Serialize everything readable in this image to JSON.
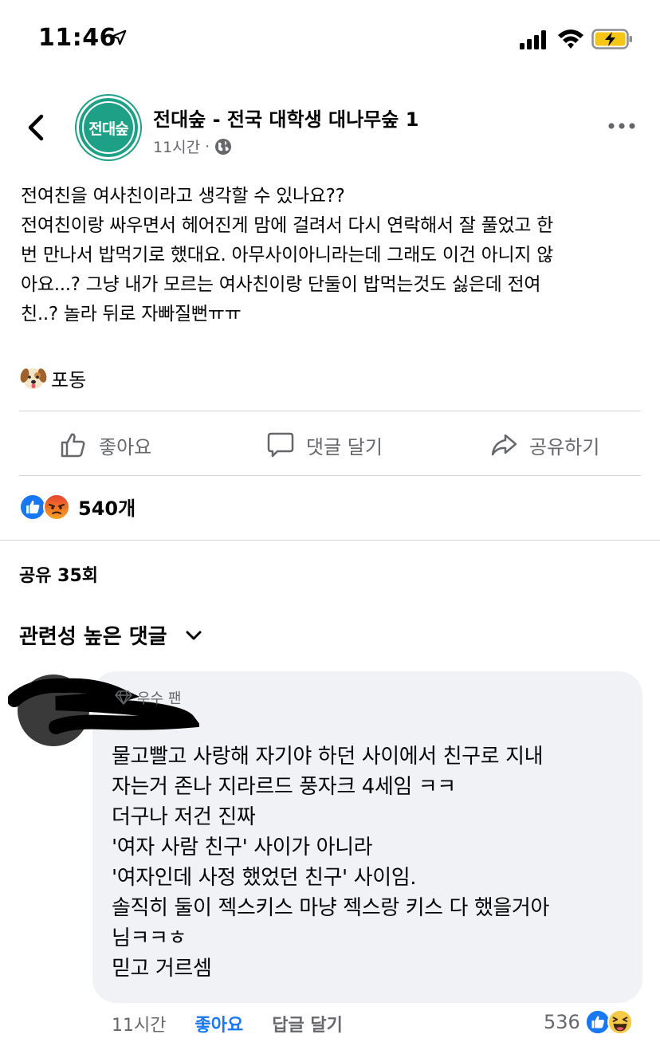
{
  "status_bar": {
    "time": "11:46"
  },
  "post": {
    "page_name": "전대숲 - 전국 대학생 대나무숲 1",
    "avatar_text": "전대숲",
    "avatar_color": "#1ea086",
    "time": "11시간",
    "separator": "·",
    "body_lines": [
      "전여친을 여사친이라고 생각할 수 있나요??",
      "전여친이랑 싸우면서 헤어진게 맘에 걸려서 다시 연락해서 잘 풀었고 한",
      "번 만나서 밥먹기로 했대요. 아무사이아니라는데 그래도 이건 아니지 않",
      "아요...? 그냥 내가 모르는 여사친이랑 단둘이 밥먹는것도 싫은데 전여",
      "친..? 놀라 뒤로 자빠질뻔ㅠㅠ"
    ],
    "signature": "포동"
  },
  "actions": {
    "like_label": "좋아요",
    "comment_label": "댓글 달기",
    "share_label": "공유하기"
  },
  "reactions": {
    "count": "540개"
  },
  "shares": {
    "label": "공유 35회"
  },
  "comments": {
    "filter_label": "관련성 높은 댓글",
    "items": [
      {
        "badge": "우수 팬",
        "lines": [
          "물고빨고 사랑해 자기야 하던 사이에서 친구로 지내",
          "자는거 존나 지라르드 풍자크 4세임 ㅋㅋ",
          "더구나 저건 진짜",
          "'여자 사람 친구' 사이가 아니라",
          "'여자인데 사정 했었던 친구' 사이임.",
          "솔직히 둘이 젝스키스 마냥 젝스랑 키스 다 했을거아",
          "님ㅋㅋㅎ",
          "믿고 거르셈"
        ],
        "time": "11시간",
        "like_label": "좋아요",
        "reply_label": "답글 달기",
        "reaction_count": "536"
      }
    ]
  },
  "colors": {
    "fb_blue": "#1877f2",
    "meta_gray": "#65676b",
    "bubble_bg": "#f0f2f5"
  }
}
